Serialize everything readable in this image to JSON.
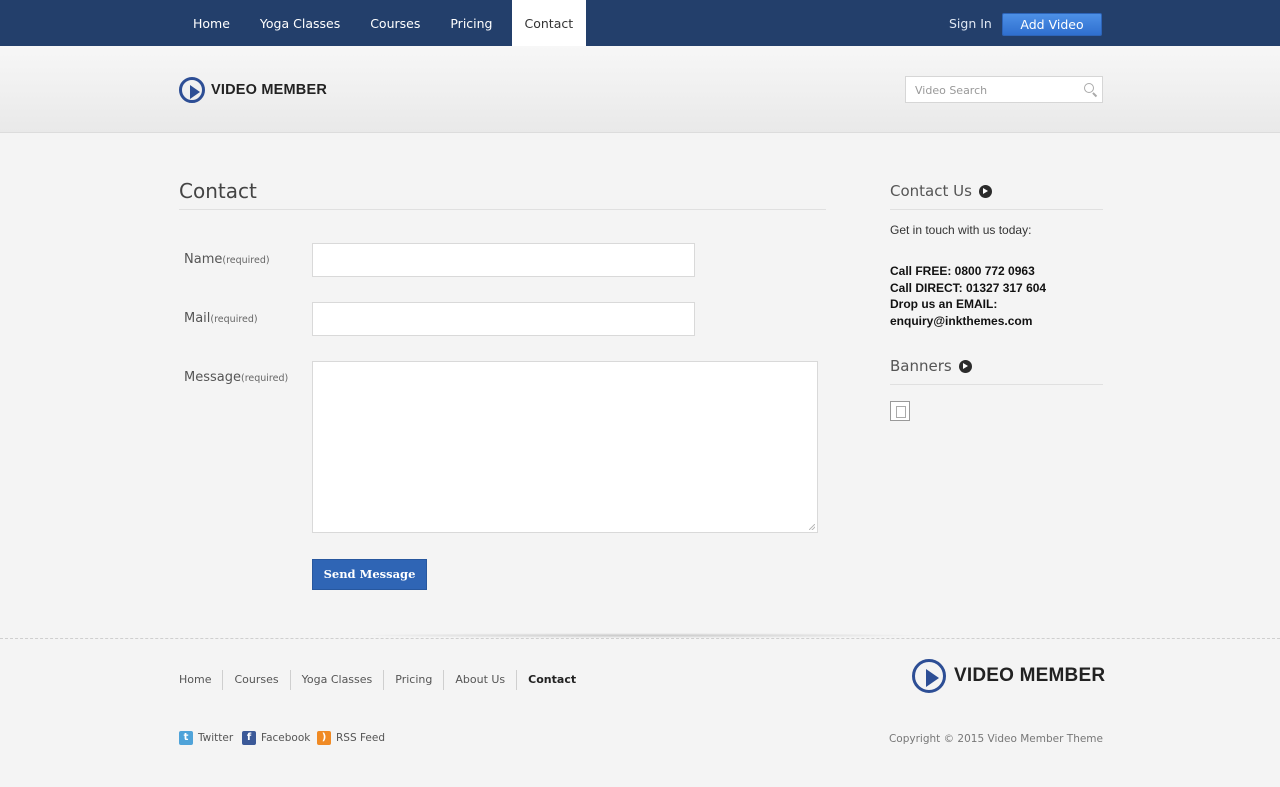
{
  "topnav": {
    "items": [
      "Home",
      "Yoga Classes",
      "Courses",
      "Pricing",
      "Contact"
    ],
    "active": "Contact",
    "signin_label": "Sign In",
    "add_video_label": "Add Video"
  },
  "brand": {
    "name": "VIDEO MEMBER"
  },
  "search": {
    "placeholder": "Video Search"
  },
  "main": {
    "title": "Contact",
    "form": {
      "name_label": "Name",
      "mail_label": "Mail",
      "message_label": "Message",
      "required_hint": "(required)",
      "name_value": "",
      "mail_value": "",
      "message_value": "",
      "submit_label": "Send Message"
    }
  },
  "sidebar": {
    "contact_heading": "Contact Us",
    "intro": "Get in touch with us today:",
    "call_free": "Call FREE: 0800 772 0963",
    "call_direct": "Call DIRECT: 01327 317 604",
    "drop_email": "Drop us an EMAIL:",
    "email": "enquiry@inkthemes.com",
    "banners_heading": "Banners"
  },
  "footer": {
    "nav": [
      "Home",
      "Courses",
      "Yoga Classes",
      "Pricing",
      "About Us",
      "Contact"
    ],
    "current": "Contact",
    "social": [
      "Twitter",
      "Facebook",
      "RSS Feed"
    ],
    "copyright": "Copyright © 2015 Video Member Theme"
  },
  "colors": {
    "nav_bg": "#233f6b",
    "accent": "#2f65b5",
    "brand": "#2d4e95"
  },
  "icons": [
    "play-circle-icon",
    "search-icon",
    "arrow-right-circle-icon",
    "broken-image-icon",
    "twitter-icon",
    "facebook-icon",
    "rss-icon",
    "resize-grip-icon"
  ]
}
